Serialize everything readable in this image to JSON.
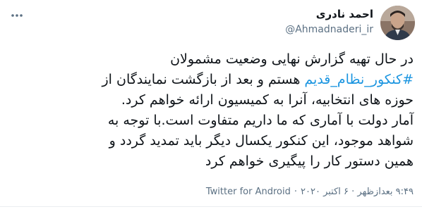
{
  "author": {
    "display_name": "احمد نادری",
    "handle": "@Ahmadnaderi_ir"
  },
  "more_icon": "more-dots-icon",
  "tweet": {
    "lines": [
      {
        "text": "در حال تهیه گزارش نهایی وضعیت مشمولان"
      },
      {
        "hashtag": "#کنکور_نظام_قدیم",
        "text": " هستم و بعد از بازگشت نمایندگان از"
      },
      {
        "text": "حوزه های انتخابیه، آنرا به کمیسیون ارائه خواهم کرد."
      },
      {
        "text": "آمار دولت با آماری که ما داریم متفاوت است.با توجه به"
      },
      {
        "text": "شواهد موجود، این کنکور یکسال دیگر باید تمدید گردد و"
      },
      {
        "text": "همین دستور کار را پیگیری خواهم کرد"
      }
    ]
  },
  "meta": {
    "time": "۹:۴۹ بعدازظهر · ۶ اکتبر ۲۰۲۰",
    "separator": "·",
    "source": "Twitter for Android"
  },
  "colors": {
    "hashtag": "#1b95e0",
    "secondary_text": "#5b7083"
  }
}
